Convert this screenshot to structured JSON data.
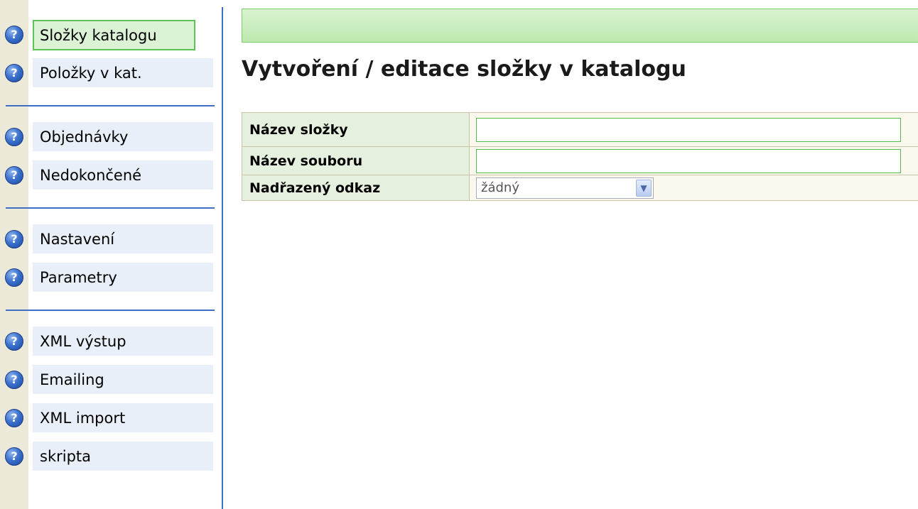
{
  "sidebar": {
    "items": [
      {
        "label": "Složky katalogu",
        "icon": "help-icon",
        "active": true
      },
      {
        "label": "Položky v kat.",
        "icon": "help-icon"
      },
      {
        "label": "Objednávky",
        "icon": "help-icon"
      },
      {
        "label": "Nedokončené",
        "icon": "help-icon"
      },
      {
        "label": "Nastavení",
        "icon": "help-icon"
      },
      {
        "label": "Parametry",
        "icon": "help-icon"
      },
      {
        "label": "XML výstup",
        "icon": "help-icon"
      },
      {
        "label": "Emailing",
        "icon": "help-icon"
      },
      {
        "label": "XML import",
        "icon": "help-icon"
      },
      {
        "label": "skripta",
        "icon": "help-icon"
      }
    ]
  },
  "main": {
    "title": "Vytvoření / editace složky v katalogu",
    "form": {
      "folder_name": {
        "label": "Název složky",
        "value": ""
      },
      "file_name": {
        "label": "Název souboru",
        "value": ""
      },
      "parent_link": {
        "label": "Nadřazený odkaz",
        "selected": "žádný"
      }
    }
  },
  "colors": {
    "accent_blue": "#3f6fc4",
    "active_green": "#5ec25a",
    "nav_bg": "#e9eff8",
    "label_bg": "#e6f0de"
  }
}
